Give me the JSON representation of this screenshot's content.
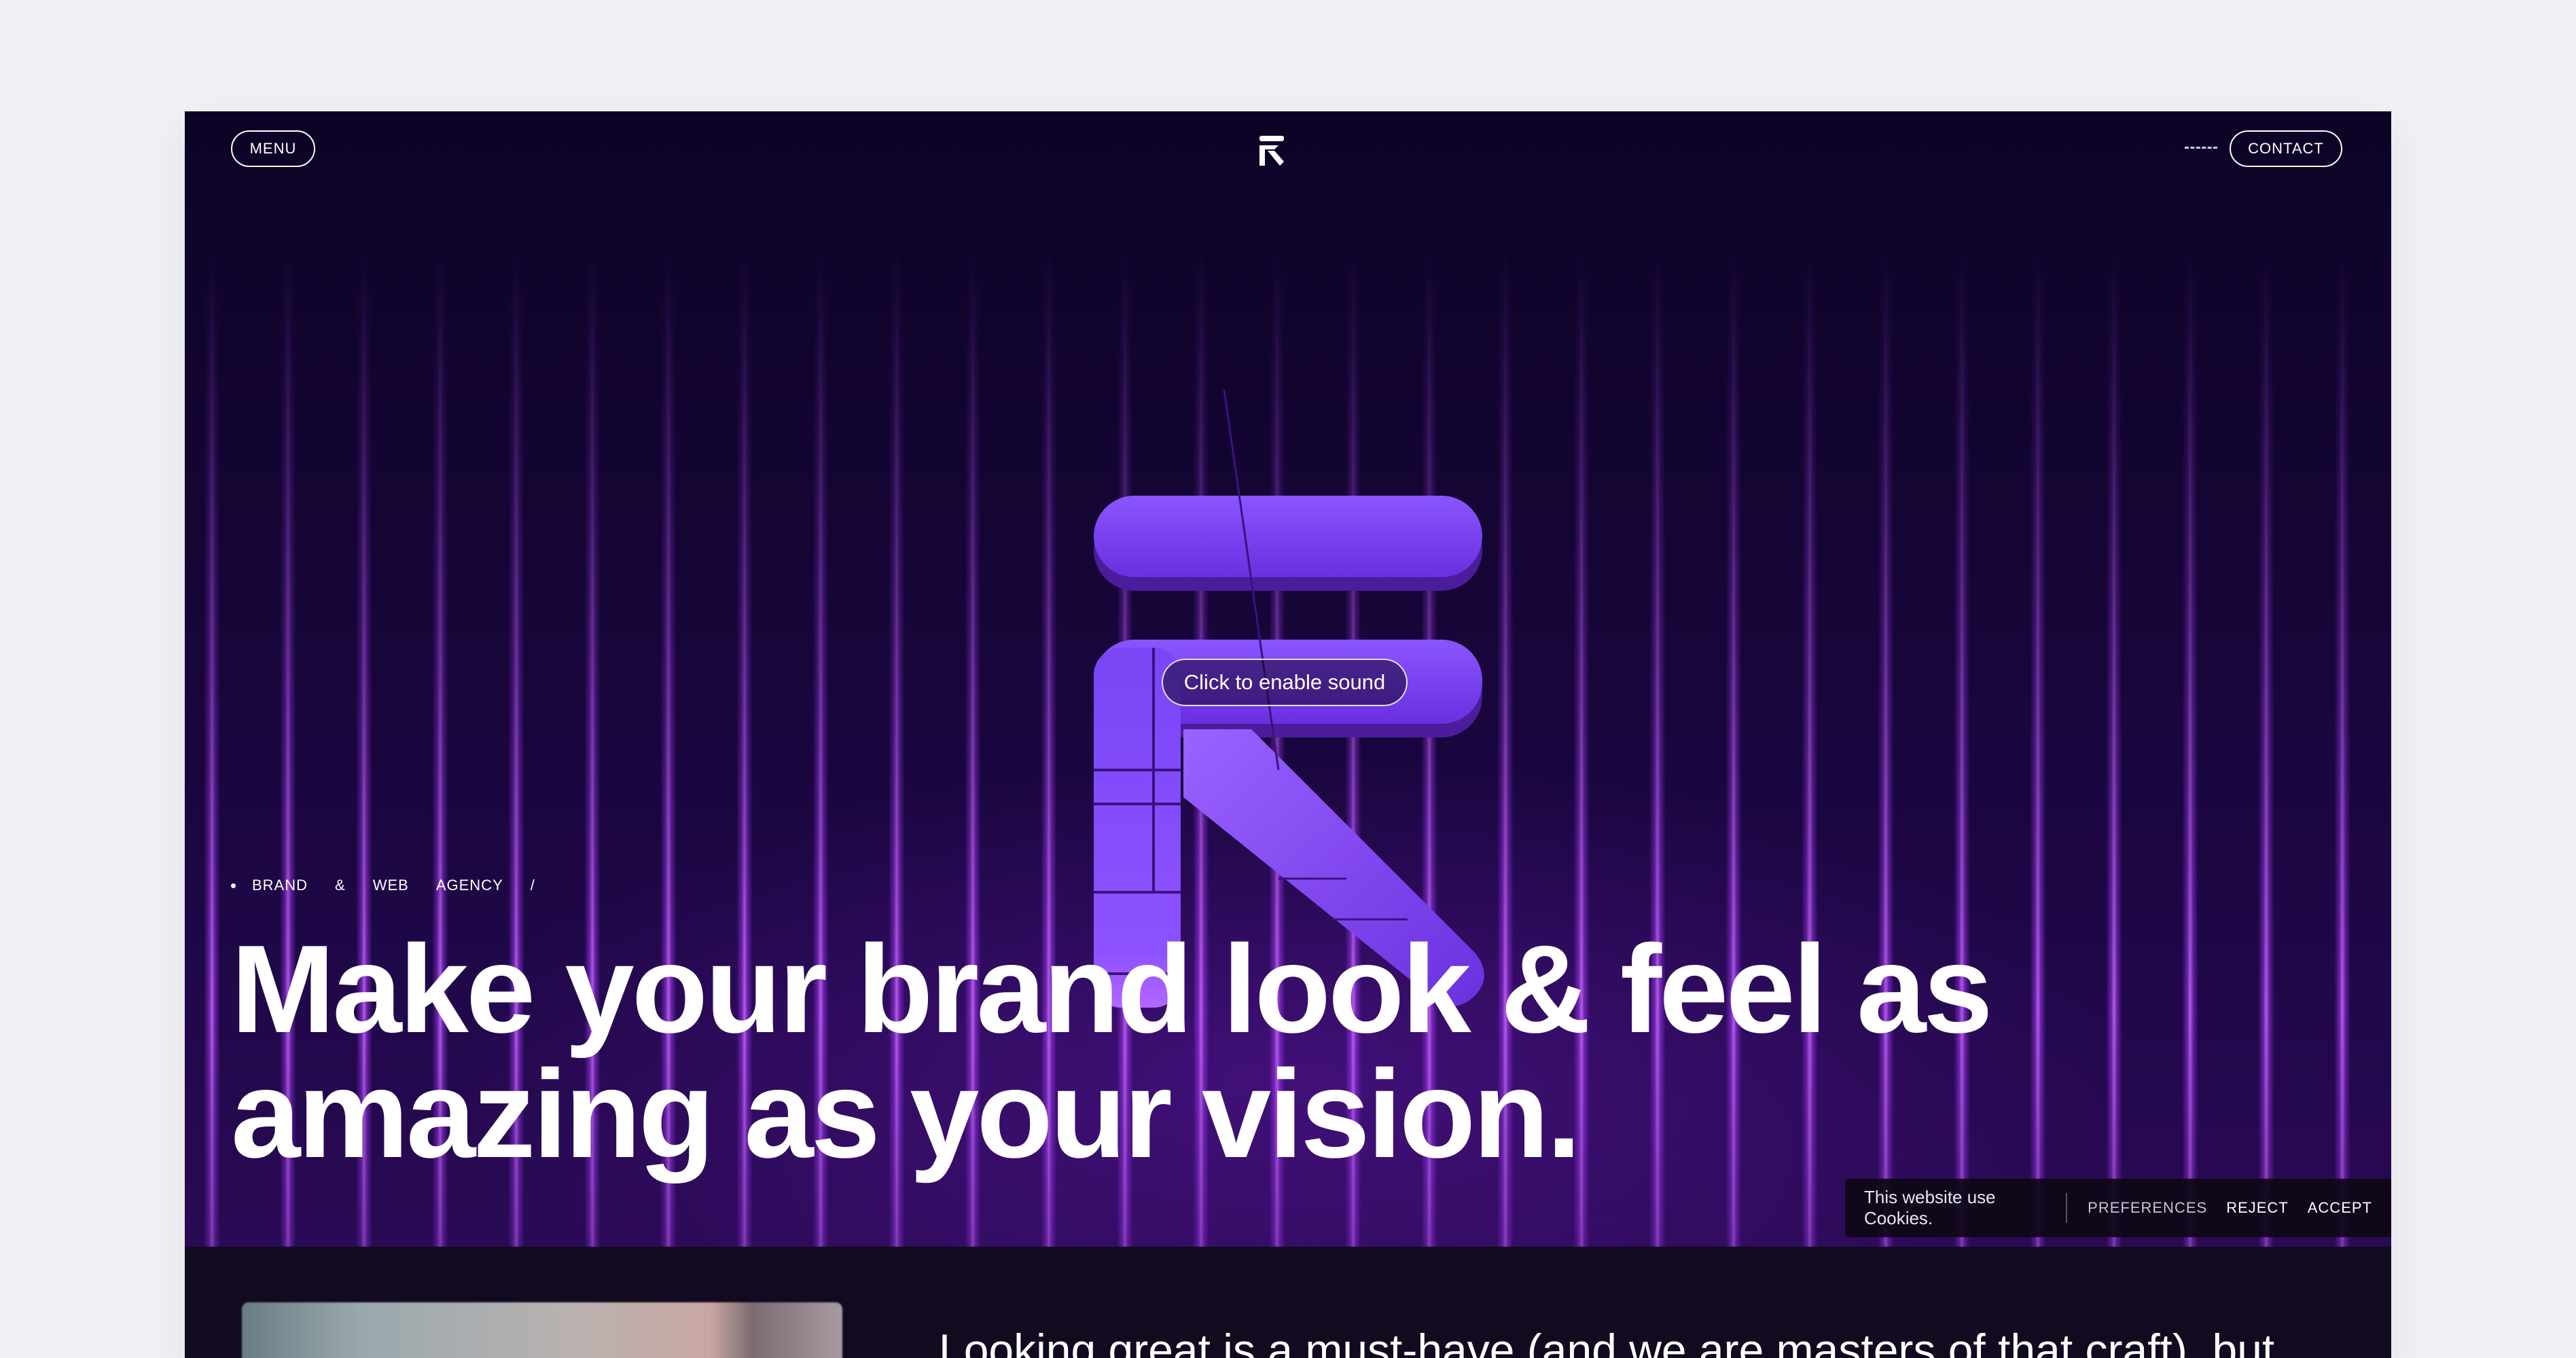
{
  "nav": {
    "menu_label": "MENU",
    "contact_label": "CONTACT",
    "dashes": "-----"
  },
  "hero": {
    "sound_label": "Click to enable sound",
    "eyebrow": [
      "BRAND",
      "&",
      "WEB",
      "AGENCY",
      "/"
    ],
    "headline_line1": "Make your brand look & feel as",
    "headline_line2": "amazing as your vision."
  },
  "intro": {
    "text": "Looking great is a must-have (and we are masters of that craft), but"
  },
  "cookies": {
    "message": "This website use Cookies.",
    "preferences_label": "PREFERENCES",
    "reject_label": "REJECT",
    "accept_label": "ACCEPT"
  },
  "colors": {
    "background": "#0b0420",
    "accent": "#8b4dff",
    "accent_light": "#a066ff",
    "text": "#ffffff"
  },
  "icons": {
    "logo": "brand-r-arrow-icon"
  }
}
